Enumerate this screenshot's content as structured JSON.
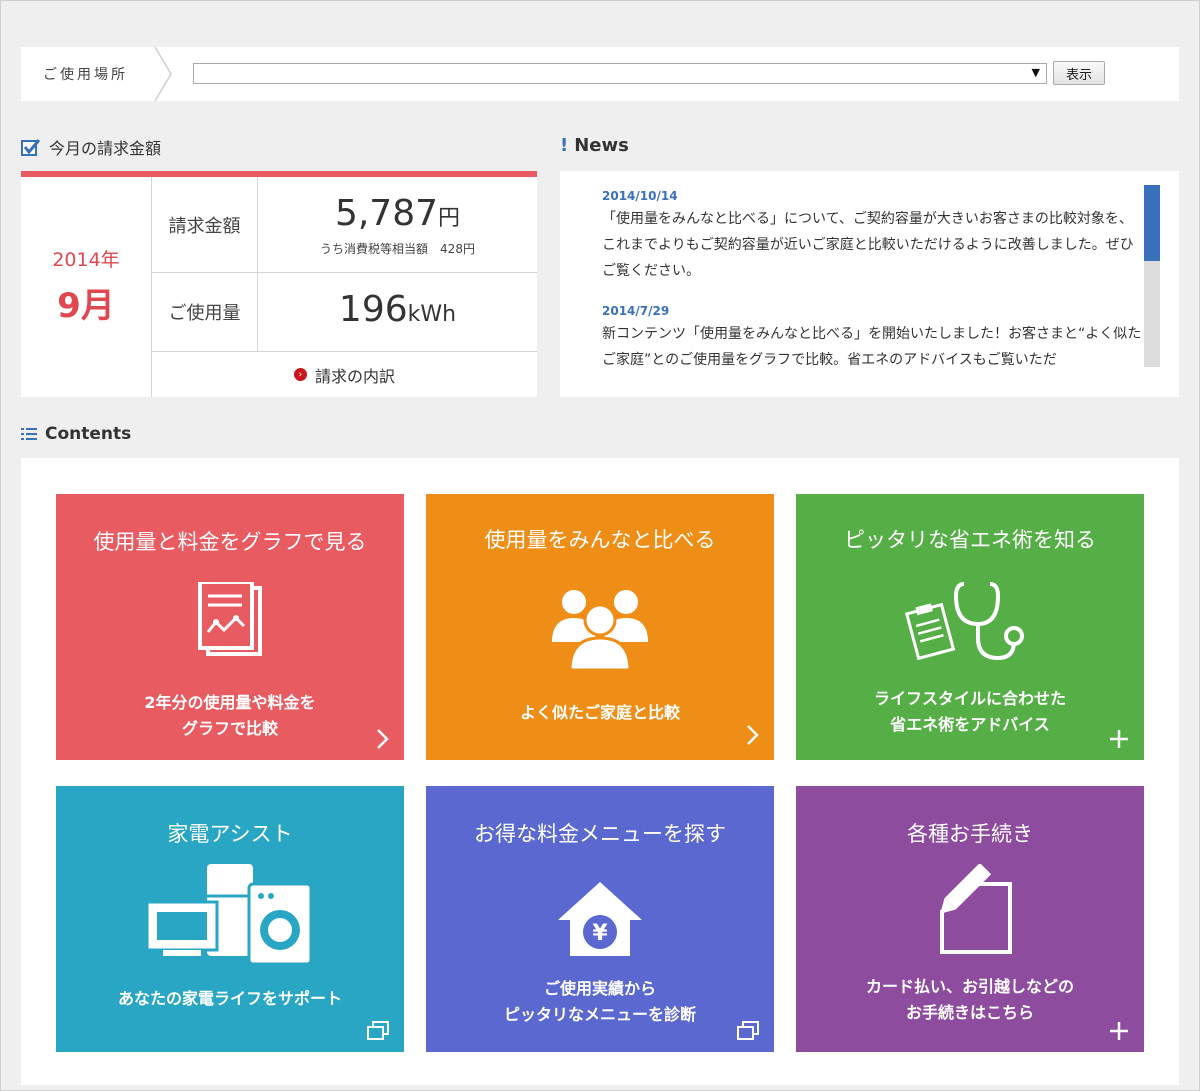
{
  "location": {
    "label": "ご使用場所",
    "selected": "",
    "show_button": "表示"
  },
  "bill": {
    "heading": "今月の請求金額",
    "year": "2014年",
    "month": "9月",
    "amount_label": "請求金額",
    "amount": "5,787",
    "amount_unit": "円",
    "tax_note": "うち消費税等相当額　428円",
    "usage_label": "ご使用量",
    "usage": "196",
    "usage_unit": "kWh",
    "detail_link": "請求の内訳"
  },
  "news": {
    "heading": "News",
    "items": [
      {
        "date": "2014/10/14",
        "text": "「使用量をみんなと比べる」について、ご契約容量が大きいお客さまの比較対象を、これまでよりもご契約容量が近いご家庭と比較いただけるように改善しました。ぜひご覧ください。"
      },
      {
        "date": "2014/7/29",
        "text": "新コンテンツ「使用量をみんなと比べる」を開始いたしました！お客さまと“よく似たご家庭”とのご使用量をグラフで比較。省エネのアドバイスもご覧いただ"
      }
    ]
  },
  "contents": {
    "heading": "Contents",
    "tiles": [
      {
        "title": "使用量と料金をグラフで見る",
        "desc1": "2年分の使用量や料金を",
        "desc2": "グラフで比較",
        "color": "#e85b61",
        "icon": "chart-document-icon",
        "corner": "chevron-right-icon"
      },
      {
        "title": "使用量をみんなと比べる",
        "desc1": "よく似たご家庭と比較",
        "desc2": "",
        "color": "#ee8e17",
        "icon": "group-people-icon",
        "corner": "chevron-right-icon"
      },
      {
        "title": "ピッタリな省エネ術を知る",
        "desc1": "ライフスタイルに合わせた",
        "desc2": "省エネ術をアドバイス",
        "color": "#56ae46",
        "icon": "stethoscope-clipboard-icon",
        "corner": "plus-icon"
      },
      {
        "title": "家電アシスト",
        "desc1": "あなたの家電ライフをサポート",
        "desc2": "",
        "color": "#29a6c3",
        "icon": "home-appliances-icon",
        "corner": "new-window-icon"
      },
      {
        "title": "お得な料金メニューを探す",
        "desc1": "ご使用実績から",
        "desc2": "ピッタリなメニューを診断",
        "color": "#5a68cf",
        "icon": "house-yen-icon",
        "corner": "new-window-icon"
      },
      {
        "title": "各種お手続き",
        "desc1": "カード払い、お引越しなどの",
        "desc2": "お手続きはこちら",
        "color": "#8e4c9f",
        "icon": "pen-edit-icon",
        "corner": "plus-icon"
      }
    ]
  }
}
